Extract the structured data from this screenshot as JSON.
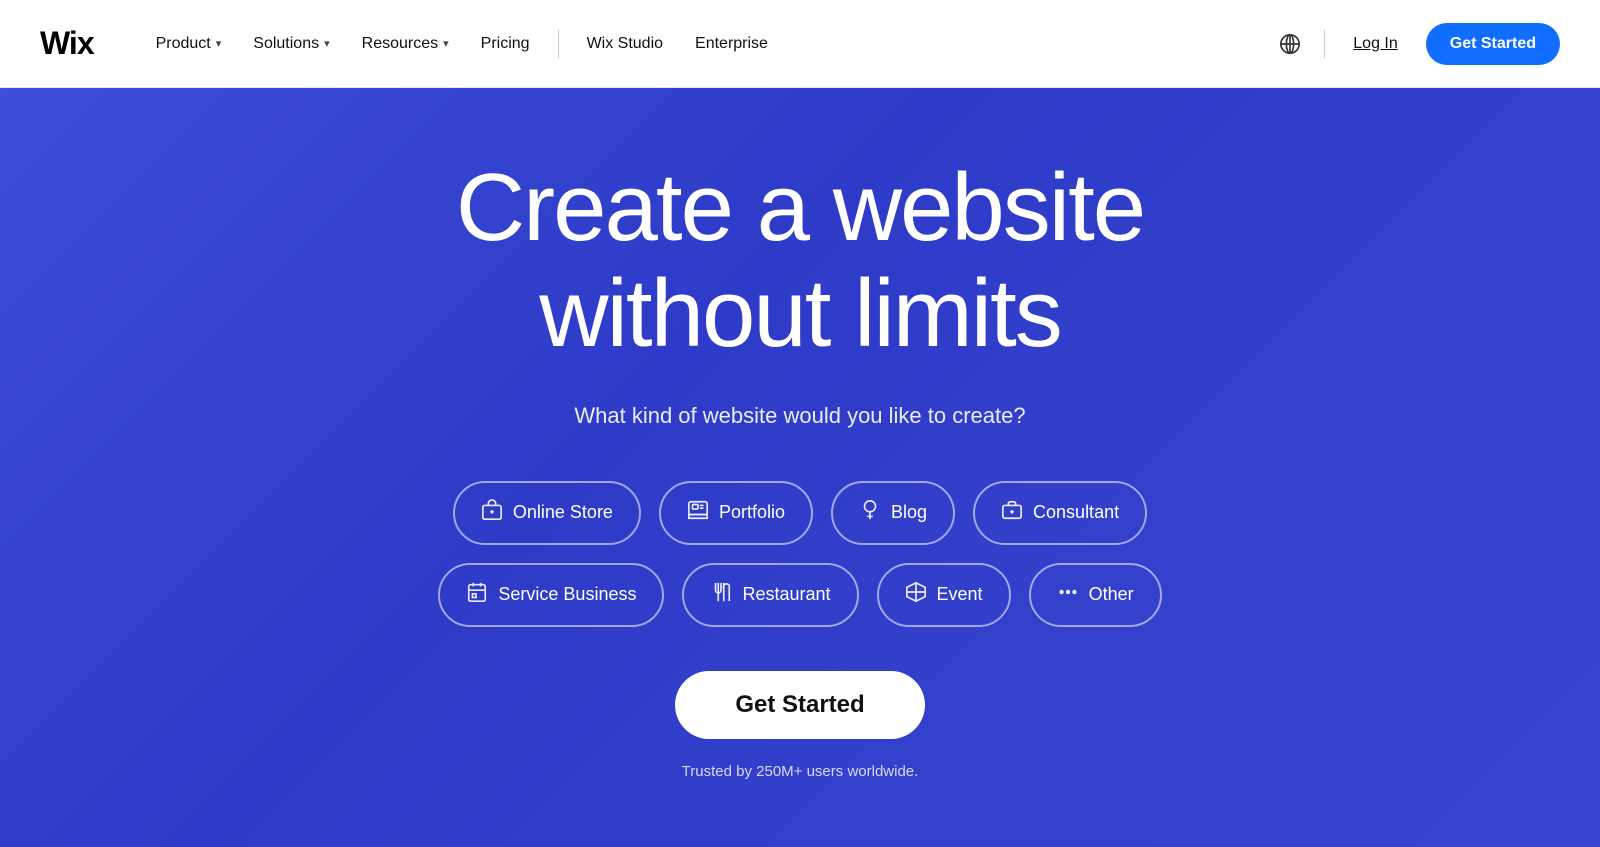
{
  "nav": {
    "logo": "Wix",
    "links": [
      {
        "label": "Product",
        "has_dropdown": true
      },
      {
        "label": "Solutions",
        "has_dropdown": true
      },
      {
        "label": "Resources",
        "has_dropdown": true
      },
      {
        "label": "Pricing",
        "has_dropdown": false
      },
      {
        "label": "Wix Studio",
        "has_dropdown": false
      },
      {
        "label": "Enterprise",
        "has_dropdown": false
      }
    ],
    "login_label": "Log In",
    "get_started_label": "Get Started"
  },
  "hero": {
    "title": "Create a website without limits",
    "subtitle": "What kind of website would you like to create?",
    "website_types_row1": [
      {
        "label": "Online Store",
        "icon": "🛍"
      },
      {
        "label": "Portfolio",
        "icon": "🖼"
      },
      {
        "label": "Blog",
        "icon": "💡"
      },
      {
        "label": "Consultant",
        "icon": "💼"
      }
    ],
    "website_types_row2": [
      {
        "label": "Service Business",
        "icon": "📅"
      },
      {
        "label": "Restaurant",
        "icon": "🍴"
      },
      {
        "label": "Event",
        "icon": "🏷"
      },
      {
        "label": "Other",
        "icon": "···"
      }
    ],
    "get_started_label": "Get Started",
    "trusted_text": "Trusted by 250M+ users worldwide."
  },
  "colors": {
    "hero_bg": "#3441dc",
    "nav_get_started": "#116dff",
    "white": "#ffffff"
  }
}
